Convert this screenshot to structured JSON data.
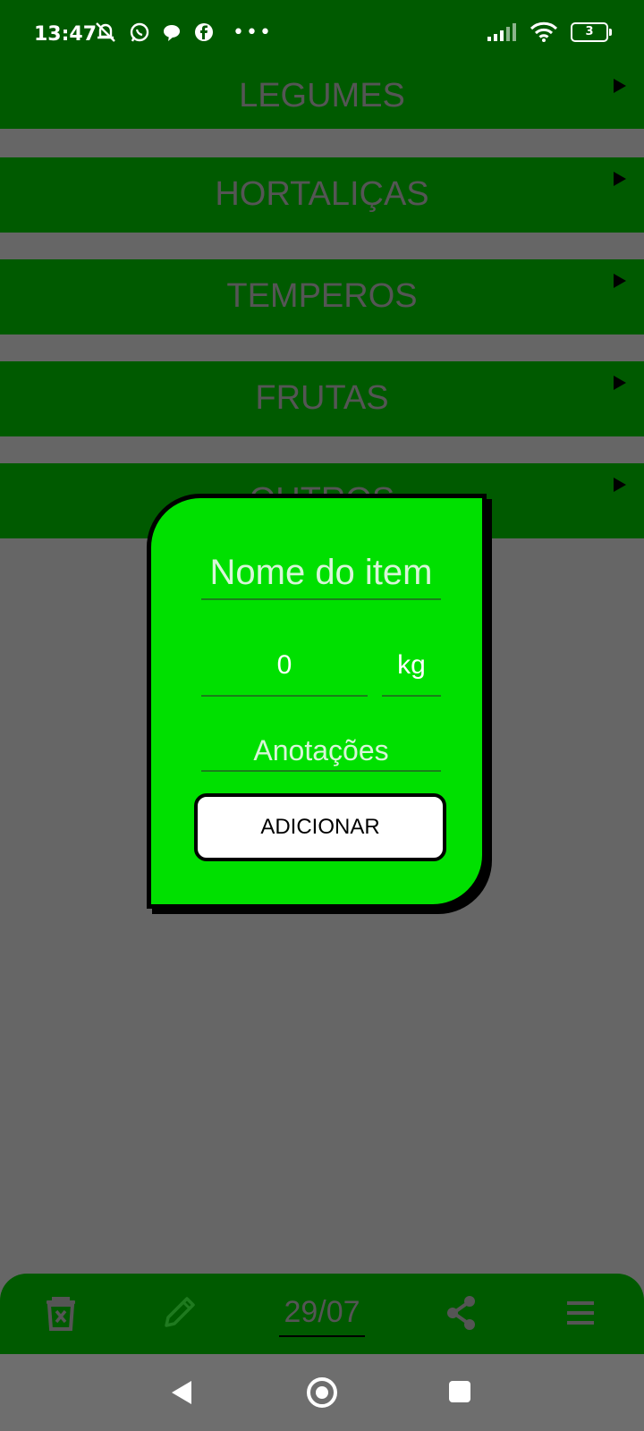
{
  "status_bar": {
    "time": "13:47",
    "battery_level": "3",
    "left_icons": [
      "muted-bell-icon",
      "whatsapp-icon",
      "chat-bubble-icon",
      "facebook-icon",
      "more-dots-icon"
    ],
    "right_icons": [
      "signal-icon",
      "wifi-icon",
      "battery-icon"
    ]
  },
  "categories": [
    {
      "label": "LEGUMES"
    },
    {
      "label": "HORTALIÇAS"
    },
    {
      "label": "TEMPEROS"
    },
    {
      "label": "FRUTAS"
    },
    {
      "label": "OUTROS"
    }
  ],
  "dialog": {
    "name_placeholder": "Nome do item",
    "quantity_value": "0",
    "unit_value": "kg",
    "notes_placeholder": "Anotações",
    "add_label": "ADICIONAR"
  },
  "bottom_bar": {
    "date": "29/07",
    "icons": [
      "trash-icon",
      "pencil-icon",
      "share-icon",
      "menu-icon"
    ]
  },
  "colors": {
    "header_green": "#005a00",
    "dialog_green": "#00e000",
    "overlay_gray": "#666666"
  }
}
